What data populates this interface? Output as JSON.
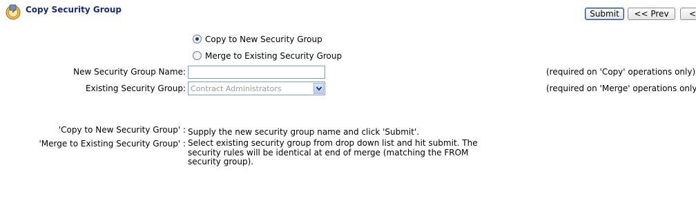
{
  "header": {
    "title": "Copy Security Group",
    "logo_icon": "security-group-icon"
  },
  "toolbar": {
    "submit_label": "Submit",
    "prev_label": "<< Prev",
    "first_label": "<<"
  },
  "mode": {
    "selected": "copy",
    "options": [
      {
        "id": "copy",
        "label": "Copy to New Security Group",
        "checked": true
      },
      {
        "id": "merge",
        "label": "Merge to Existing Security Group",
        "checked": false
      }
    ]
  },
  "form": {
    "new_name_label": "New Security Group Name:",
    "new_name_value": "",
    "existing_label": "Existing Security Group:",
    "existing_value": "Contract Administrators",
    "copy_note": "(required on 'Copy' operations only)",
    "merge_note": "(required on 'Merge' operations only)"
  },
  "help": [
    {
      "term": "'Copy to New Security Group' :",
      "description": "Supply the new security group name and click 'Submit'."
    },
    {
      "term": "'Merge to Existing Security Group' :",
      "description": "Select existing security group from drop down list and hit submit. The security rules will be identical at end of merge (matching the FROM security group)."
    }
  ],
  "colors": {
    "title": "#1a2a7a",
    "submit_border": "#1f4f8f",
    "field_border": "#7f9db9"
  }
}
